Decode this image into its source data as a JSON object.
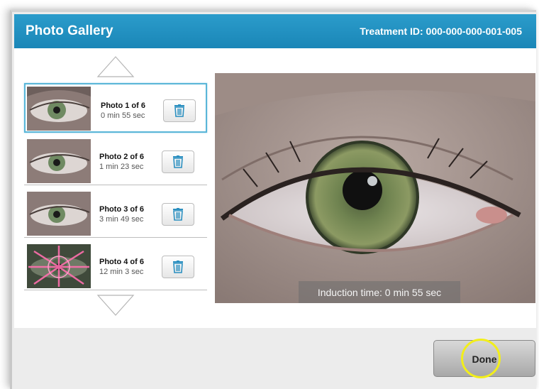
{
  "header": {
    "title": "Photo Gallery",
    "treatment_id": "Treatment ID:  000-000-000-001-005"
  },
  "thumbnails": [
    {
      "title": "Photo 1 of 6",
      "time": "0 min 55 sec",
      "selected": true
    },
    {
      "title": "Photo 2 of 6",
      "time": "1 min 23 sec",
      "selected": false
    },
    {
      "title": "Photo 3 of 6",
      "time": "3 min 49 sec",
      "selected": false
    },
    {
      "title": "Photo 4 of 6",
      "time": "12 min 3 sec",
      "selected": false
    }
  ],
  "main_photo": {
    "caption": "Induction time: 0 min 55 sec"
  },
  "footer": {
    "done_label": "Done"
  },
  "colors": {
    "header_bg": "#1a86b7",
    "selected_border": "#5ab6d8",
    "highlight_ring": "#f2ee1a",
    "trash_icon": "#2a8fc0"
  },
  "icons": {
    "scroll_up": "triangle-up-icon",
    "scroll_down": "triangle-down-icon",
    "delete": "trash-icon"
  }
}
